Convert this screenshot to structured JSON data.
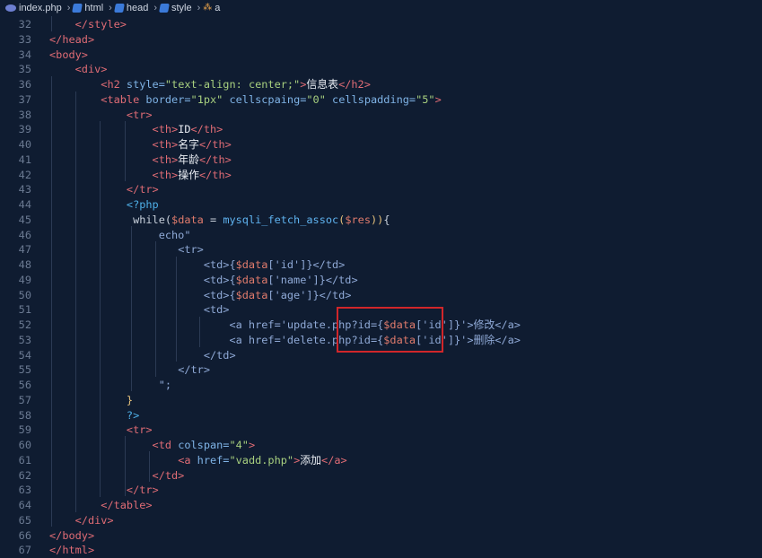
{
  "breadcrumb": {
    "items": [
      "index.php",
      "html",
      "head",
      "style",
      "a"
    ]
  },
  "editor": {
    "lines": [
      {
        "n": "32",
        "tokens": [
          [
            "punct",
            "    "
          ],
          [
            "tag",
            "</style>"
          ]
        ]
      },
      {
        "n": "33",
        "tokens": [
          [
            "tag",
            "</head>"
          ]
        ]
      },
      {
        "n": "34",
        "tokens": [
          [
            "tag",
            "<body>"
          ]
        ]
      },
      {
        "n": "35",
        "tokens": [
          [
            "punct",
            "    "
          ],
          [
            "tag",
            "<div>"
          ]
        ]
      },
      {
        "n": "36",
        "tokens": [
          [
            "punct",
            "        "
          ],
          [
            "tag",
            "<h2 "
          ],
          [
            "attr",
            "style="
          ],
          [
            "str",
            "\"text-align: center;\""
          ],
          [
            "tag",
            ">"
          ],
          [
            "txt",
            "信息表"
          ],
          [
            "tag",
            "</h2>"
          ]
        ]
      },
      {
        "n": "37",
        "tokens": [
          [
            "punct",
            "        "
          ],
          [
            "tag",
            "<table "
          ],
          [
            "attr",
            "border="
          ],
          [
            "str",
            "\"1px\" "
          ],
          [
            "attr",
            "cellscpaing="
          ],
          [
            "str",
            "\"0\" "
          ],
          [
            "attr",
            "cellspadding="
          ],
          [
            "str",
            "\"5\""
          ],
          [
            "tag",
            ">"
          ]
        ]
      },
      {
        "n": "38",
        "tokens": [
          [
            "punct",
            "            "
          ],
          [
            "tag",
            "<tr>"
          ]
        ]
      },
      {
        "n": "39",
        "tokens": [
          [
            "punct",
            "                "
          ],
          [
            "tag",
            "<th>"
          ],
          [
            "txt",
            "ID"
          ],
          [
            "tag",
            "</th>"
          ]
        ]
      },
      {
        "n": "40",
        "tokens": [
          [
            "punct",
            "                "
          ],
          [
            "tag",
            "<th>"
          ],
          [
            "txt",
            "名字"
          ],
          [
            "tag",
            "</th>"
          ]
        ]
      },
      {
        "n": "41",
        "tokens": [
          [
            "punct",
            "                "
          ],
          [
            "tag",
            "<th>"
          ],
          [
            "txt",
            "年龄"
          ],
          [
            "tag",
            "</th>"
          ]
        ]
      },
      {
        "n": "42",
        "tokens": [
          [
            "punct",
            "                "
          ],
          [
            "tag",
            "<th>"
          ],
          [
            "txt",
            "操作"
          ],
          [
            "tag",
            "</th>"
          ]
        ]
      },
      {
        "n": "43",
        "tokens": [
          [
            "punct",
            "            "
          ],
          [
            "tag",
            "</tr>"
          ]
        ]
      },
      {
        "n": "44",
        "tokens": [
          [
            "punct",
            "            "
          ],
          [
            "php",
            "<?php"
          ]
        ]
      },
      {
        "n": "45",
        "tokens": [
          [
            "punct",
            "             "
          ],
          [
            "kw",
            "while("
          ],
          [
            "var",
            "$data"
          ],
          [
            "kw",
            " = "
          ],
          [
            "fn",
            "mysqli_fetch_assoc"
          ],
          [
            "yel",
            "("
          ],
          [
            "var",
            "$res"
          ],
          [
            "yel",
            "))"
          ],
          [
            "kw",
            "{"
          ]
        ]
      },
      {
        "n": "46",
        "tokens": [
          [
            "punct",
            "                 "
          ],
          [
            "echo",
            "echo\""
          ]
        ]
      },
      {
        "n": "47",
        "tokens": [
          [
            "punct",
            "                    "
          ],
          [
            "echo",
            "<tr>"
          ]
        ]
      },
      {
        "n": "48",
        "tokens": [
          [
            "punct",
            "                        "
          ],
          [
            "echo",
            "<td>{"
          ],
          [
            "var",
            "$data"
          ],
          [
            "echo",
            "['id']}</td>"
          ]
        ]
      },
      {
        "n": "49",
        "tokens": [
          [
            "punct",
            "                        "
          ],
          [
            "echo",
            "<td>{"
          ],
          [
            "var",
            "$data"
          ],
          [
            "echo",
            "['name']}</td>"
          ]
        ]
      },
      {
        "n": "50",
        "tokens": [
          [
            "punct",
            "                        "
          ],
          [
            "echo",
            "<td>{"
          ],
          [
            "var",
            "$data"
          ],
          [
            "echo",
            "['age']}</td>"
          ]
        ]
      },
      {
        "n": "51",
        "tokens": [
          [
            "punct",
            "                        "
          ],
          [
            "echo",
            "<td>"
          ]
        ]
      },
      {
        "n": "52",
        "tokens": [
          [
            "punct",
            "                            "
          ],
          [
            "echo",
            "<a href='update.php?id={"
          ],
          [
            "var",
            "$data"
          ],
          [
            "echo",
            "['id']}'>修改</a>"
          ]
        ]
      },
      {
        "n": "53",
        "tokens": [
          [
            "punct",
            "                            "
          ],
          [
            "echo",
            "<a href='delete.php?id={"
          ],
          [
            "var",
            "$data"
          ],
          [
            "echo",
            "['id']}'>删除</a>"
          ]
        ]
      },
      {
        "n": "54",
        "tokens": [
          [
            "punct",
            "                        "
          ],
          [
            "echo",
            "</td>"
          ]
        ]
      },
      {
        "n": "55",
        "tokens": [
          [
            "punct",
            "                    "
          ],
          [
            "echo",
            "</tr>"
          ]
        ]
      },
      {
        "n": "56",
        "tokens": [
          [
            "punct",
            "                 "
          ],
          [
            "echo",
            "\";"
          ]
        ]
      },
      {
        "n": "57",
        "tokens": [
          [
            "punct",
            "            "
          ],
          [
            "yel",
            "}"
          ]
        ]
      },
      {
        "n": "58",
        "tokens": [
          [
            "punct",
            "            "
          ],
          [
            "php",
            "?>"
          ]
        ]
      },
      {
        "n": "59",
        "tokens": [
          [
            "punct",
            "            "
          ],
          [
            "tag",
            "<tr>"
          ]
        ]
      },
      {
        "n": "60",
        "tokens": [
          [
            "punct",
            "                "
          ],
          [
            "tag",
            "<td "
          ],
          [
            "attr",
            "colspan="
          ],
          [
            "str",
            "\"4\""
          ],
          [
            "tag",
            ">"
          ]
        ]
      },
      {
        "n": "61",
        "tokens": [
          [
            "punct",
            "                    "
          ],
          [
            "tag",
            "<a "
          ],
          [
            "attr",
            "href="
          ],
          [
            "str",
            "\"vadd.php\""
          ],
          [
            "tag",
            ">"
          ],
          [
            "txt",
            "添加"
          ],
          [
            "tag",
            "</a>"
          ]
        ]
      },
      {
        "n": "62",
        "tokens": [
          [
            "punct",
            "                "
          ],
          [
            "tag",
            "</td>"
          ]
        ]
      },
      {
        "n": "63",
        "tokens": [
          [
            "punct",
            "            "
          ],
          [
            "tag",
            "</tr>"
          ]
        ]
      },
      {
        "n": "64",
        "tokens": [
          [
            "punct",
            "        "
          ],
          [
            "tag",
            "</table>"
          ]
        ]
      },
      {
        "n": "65",
        "tokens": [
          [
            "punct",
            "    "
          ],
          [
            "tag",
            "</div>"
          ]
        ]
      },
      {
        "n": "66",
        "tokens": [
          [
            "tag",
            "</body>"
          ]
        ]
      },
      {
        "n": "67",
        "tokens": [
          [
            "tag",
            "</html>"
          ]
        ]
      }
    ]
  },
  "colors": {
    "background": "#0f1c31",
    "highlight_border": "#d1262a"
  }
}
